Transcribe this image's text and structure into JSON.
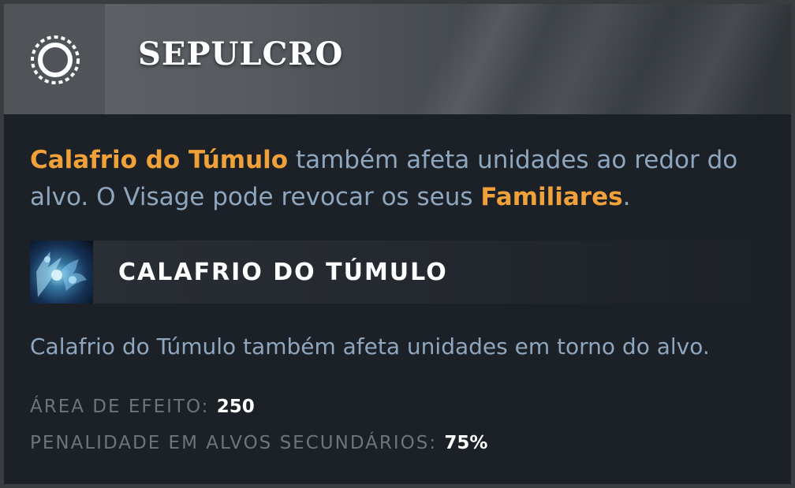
{
  "tooltip": {
    "title": "SEPULCRO",
    "icon": "dashed-ring-icon",
    "description": {
      "part1_highlight": "Calafrio do Túmulo",
      "part2": " também afeta unidades ao redor do alvo. O Visage pode revocar os seus ",
      "part3_highlight": "Familiares",
      "part4": "."
    },
    "ability": {
      "icon": "grave-chill-ability-icon",
      "name": "CALAFRIO DO TÚMULO",
      "description": "Calafrio do Túmulo também afeta unidades em torno do alvo."
    },
    "stats": [
      {
        "label": "ÁREA DE EFEITO:",
        "value": "250"
      },
      {
        "label": "PENALIDADE EM ALVOS SECUNDÁRIOS:",
        "value": "75%"
      }
    ],
    "colors": {
      "highlight": "#f0a13a",
      "text": "#8fa6bf",
      "background": "#1c2127",
      "label": "#6e7479"
    }
  }
}
